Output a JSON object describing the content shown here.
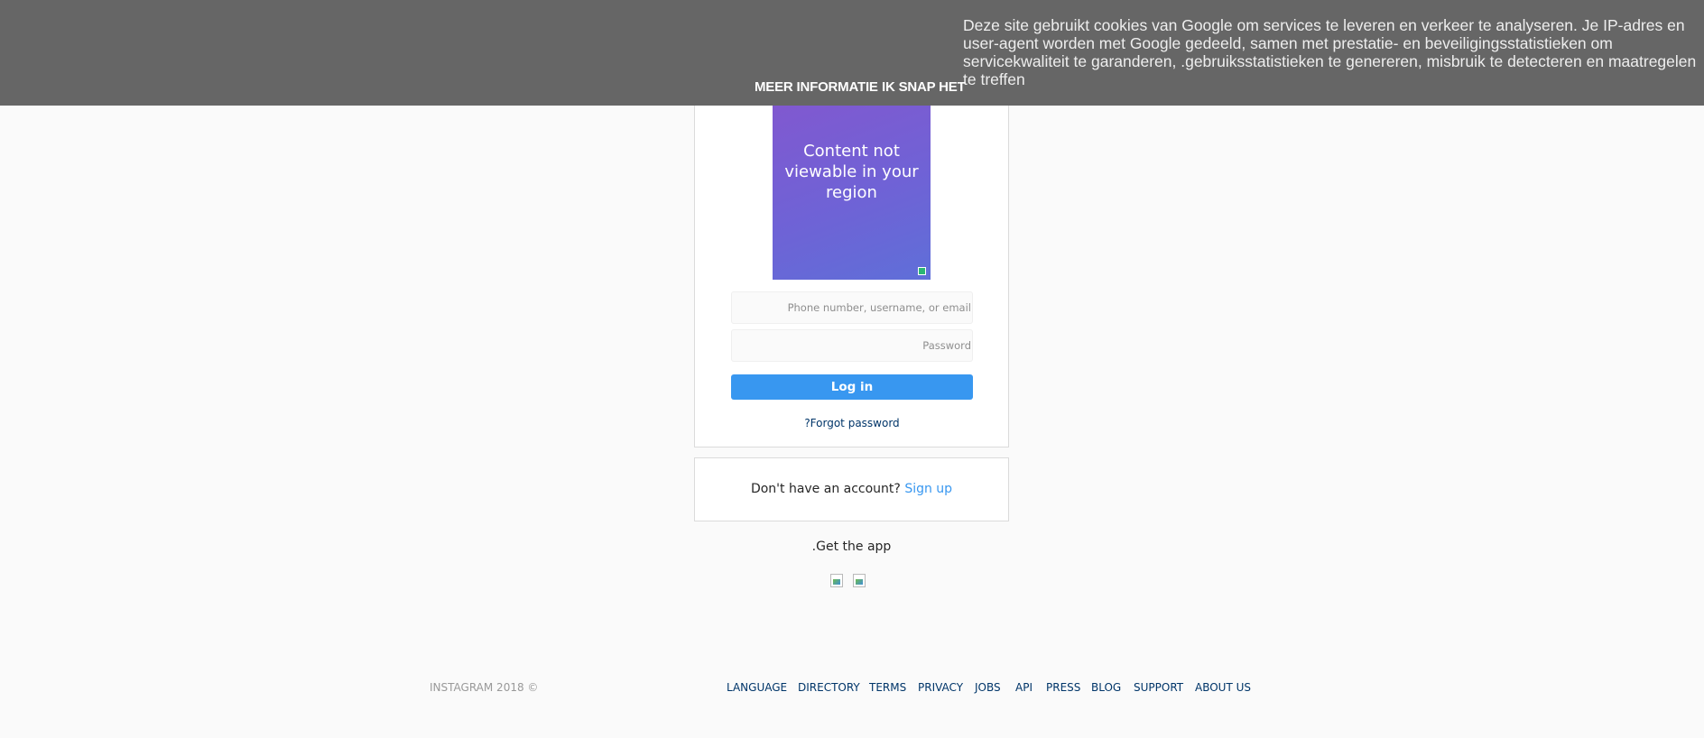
{
  "cookie_banner": {
    "message": "Deze site gebruikt cookies van Google om services te leveren en verkeer te analyseren. Je IP-adres en user-agent worden met Google gedeeld, samen met prestatie- en beveiligingsstatistieken om servicekwaliteit te garanderen, .gebruiksstatistieken te genereren, misbruik te detecteren en maatregelen te treffen",
    "more_info_label": "MEER INFORMATIE",
    "accept_label": "IK SNAP HET"
  },
  "promo": {
    "text": "Content not viewable in your region"
  },
  "login": {
    "username_placeholder": "Phone number, username, or email",
    "password_placeholder": "Password",
    "login_label": "Log in",
    "forgot_label": "?Forgot password"
  },
  "signup": {
    "prompt": "Don't have an account?",
    "link_label": "Sign up"
  },
  "app": {
    "get_app_label": ".Get the app"
  },
  "footer": {
    "copyright": "INSTAGRAM 2018 ©",
    "links": [
      "LANGUAGE",
      "DIRECTORY",
      "TERMS",
      "PRIVACY",
      "JOBS",
      "API",
      "PRESS",
      "BLOG",
      "SUPPORT",
      "ABOUT US"
    ]
  },
  "colors": {
    "banner_bg": "#666666",
    "primary_button": "#3897f0",
    "footer_link": "#003569",
    "page_bg": "#fafafa"
  }
}
